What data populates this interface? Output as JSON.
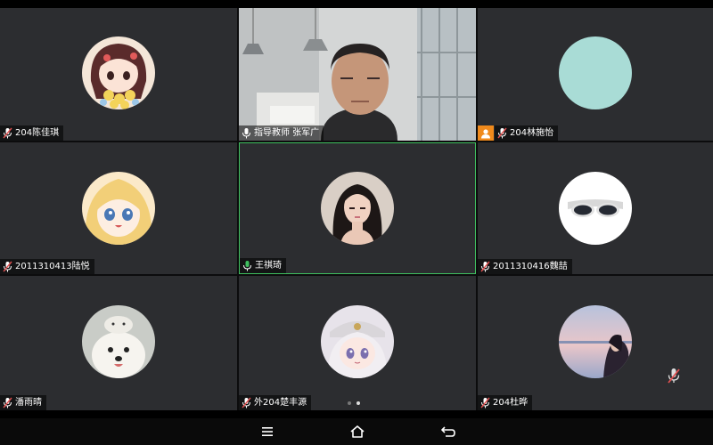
{
  "participants": [
    {
      "name": "204陈佳琪",
      "mic": "muted",
      "avatar": "avatar-anime-girl-flowers"
    },
    {
      "name": "指导教师 张军广",
      "mic": "on",
      "avatar": "camera-video-man"
    },
    {
      "name": "204林施怡",
      "mic": "muted",
      "avatar": "avatar-teal-circle",
      "host": true
    },
    {
      "name": "2011310413陆悦",
      "mic": "muted",
      "avatar": "avatar-anime-blonde-girl"
    },
    {
      "name": "王祺琦",
      "mic": "on",
      "avatar": "avatar-girl-photo",
      "active": true
    },
    {
      "name": "2011310416魏喆",
      "mic": "muted",
      "avatar": "avatar-white-sunglasses"
    },
    {
      "name": "潘雨晴",
      "mic": "muted",
      "avatar": "avatar-samoyed-dog"
    },
    {
      "name": "外204楚丰源",
      "mic": "muted",
      "avatar": "avatar-anime-white-hair"
    },
    {
      "name": "204杜晔",
      "mic": "muted",
      "avatar": "avatar-lake-photo"
    }
  ],
  "pagination": {
    "pages": 2,
    "current": 2
  },
  "navbar": [
    "menu-icon",
    "home-icon",
    "back-icon"
  ],
  "colors": {
    "tile": "#2c2d30",
    "active_border": "#3fbf5f",
    "host_badge": "#f08a1c",
    "muted_mic": "#e05050"
  }
}
